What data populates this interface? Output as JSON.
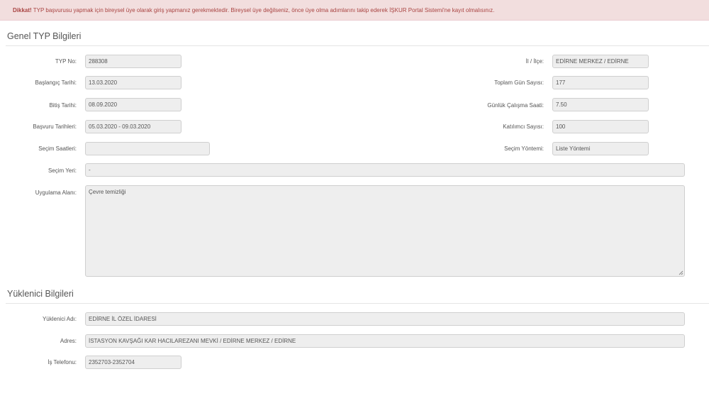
{
  "alert": {
    "strong": "Dikkat!",
    "text": " TYP başvurusu yapmak için bireysel üye olarak giriş yapmanız gerekmektedir. Bireysel üye değilseniz, önce üye olma adımlarını takip ederek İŞKUR Portal Sistemi'ne kayıt olmalısınız."
  },
  "section1": {
    "title": "Genel TYP Bilgileri",
    "fields": {
      "typ_no": {
        "label": "TYP No:",
        "value": "288308"
      },
      "baslangic": {
        "label": "Başlangıç Tarihi:",
        "value": "13.03.2020"
      },
      "bitis": {
        "label": "Bitiş Tarihi:",
        "value": "08.09.2020"
      },
      "basvuru": {
        "label": "Başvuru Tarihleri:",
        "value": "05.03.2020 - 09.03.2020"
      },
      "secim_saatleri": {
        "label": "Seçim Saatleri:",
        "value": ""
      },
      "secim_yeri": {
        "label": "Seçim Yeri:",
        "value": "-"
      },
      "uygulama_alani": {
        "label": "Uygulama Alanı:",
        "value": "Çevre temizliği"
      },
      "il_ilce": {
        "label": "İl / İlçe:",
        "value": "EDİRNE MERKEZ / EDİRNE"
      },
      "toplam_gun": {
        "label": "Toplam Gün Sayısı:",
        "value": "177"
      },
      "gunluk_saat": {
        "label": "Günlük Çalışma Saati:",
        "value": "7.50"
      },
      "katilimci": {
        "label": "Katılımcı Sayısı:",
        "value": "100"
      },
      "secim_yontemi": {
        "label": "Seçim Yöntemi:",
        "value": "Liste Yöntemi"
      }
    }
  },
  "section2": {
    "title": "Yüklenici Bilgileri",
    "fields": {
      "yuklenici_adi": {
        "label": "Yüklenici Adı:",
        "value": "EDİRNE İL ÖZEL İDARESİ"
      },
      "adres": {
        "label": "Adres:",
        "value": "İSTASYON KAVŞAĞI KAR HACILAREZANI MEVKİ / EDİRNE MERKEZ / EDİRNE"
      },
      "is_telefonu": {
        "label": "İş Telefonu:",
        "value": "2352703-2352704"
      }
    }
  }
}
